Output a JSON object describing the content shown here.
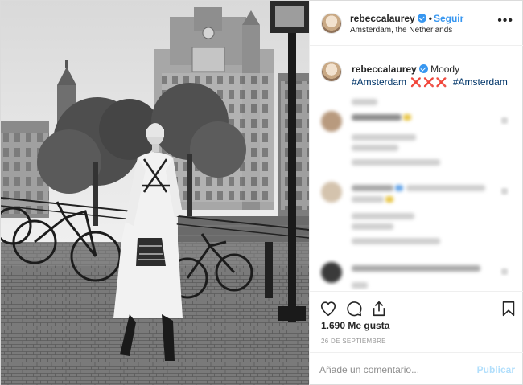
{
  "post": {
    "username": "rebeccalaurey",
    "verified": true,
    "separator": "•",
    "follow_label": "Seguir",
    "location": "Amsterdam, the Netherlands",
    "more_icon": "more-options-icon"
  },
  "caption": {
    "username": "rebeccalaurey",
    "text": "Moody",
    "hashtag_1": "#Amsterdam",
    "emoji": "❌❌❌",
    "hashtag_2": "#Amsterdam"
  },
  "comments_note": "",
  "actions": {
    "like_icon": "heart-icon",
    "comment_icon": "comment-icon",
    "share_icon": "share-icon",
    "save_icon": "bookmark-icon"
  },
  "likes": "1.690 Me gusta",
  "date": "26 DE SEPTIEMBRE",
  "comment_box": {
    "placeholder": "Añade un comentario...",
    "post_label": "Publicar"
  },
  "colors": {
    "accent": "#3897f0",
    "text": "#262626",
    "muted": "#8e8e8e",
    "disabled_post": "#b2dffc",
    "hashtag": "#003569"
  }
}
